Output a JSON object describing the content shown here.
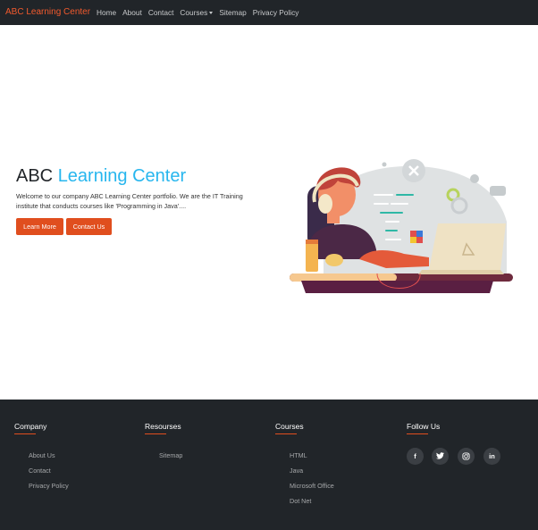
{
  "navbar": {
    "brand": "ABC Learning Center",
    "links": [
      "Home",
      "About",
      "Contact",
      "Courses",
      "Sitemap",
      "Privacy Policy"
    ]
  },
  "hero": {
    "title_part1": "ABC",
    "title_part2": "Learning Center",
    "text": "Welcome to our company ABC Learning Center portfolio. We are the IT Training institute that conducts courses like 'Programming in Java'....",
    "learn_more": "Learn More",
    "contact_us": "Contact Us"
  },
  "footer": {
    "company": {
      "title": "Company",
      "links": [
        "About Us",
        "Contact",
        "Privacy Policy"
      ]
    },
    "resources": {
      "title": "Resourses",
      "links": [
        "Sitemap"
      ]
    },
    "courses": {
      "title": "Courses",
      "links": [
        "HTML",
        "Java",
        "Microsoft Office",
        "Dot Net"
      ]
    },
    "follow": {
      "title": "Follow Us",
      "icons": [
        "facebook-icon",
        "twitter-icon",
        "instagram-icon",
        "linkedin-icon"
      ]
    }
  },
  "colors": {
    "brand": "#f25a2d",
    "accent": "#27b6ee",
    "button": "#e04e1e",
    "dark": "#212529"
  }
}
